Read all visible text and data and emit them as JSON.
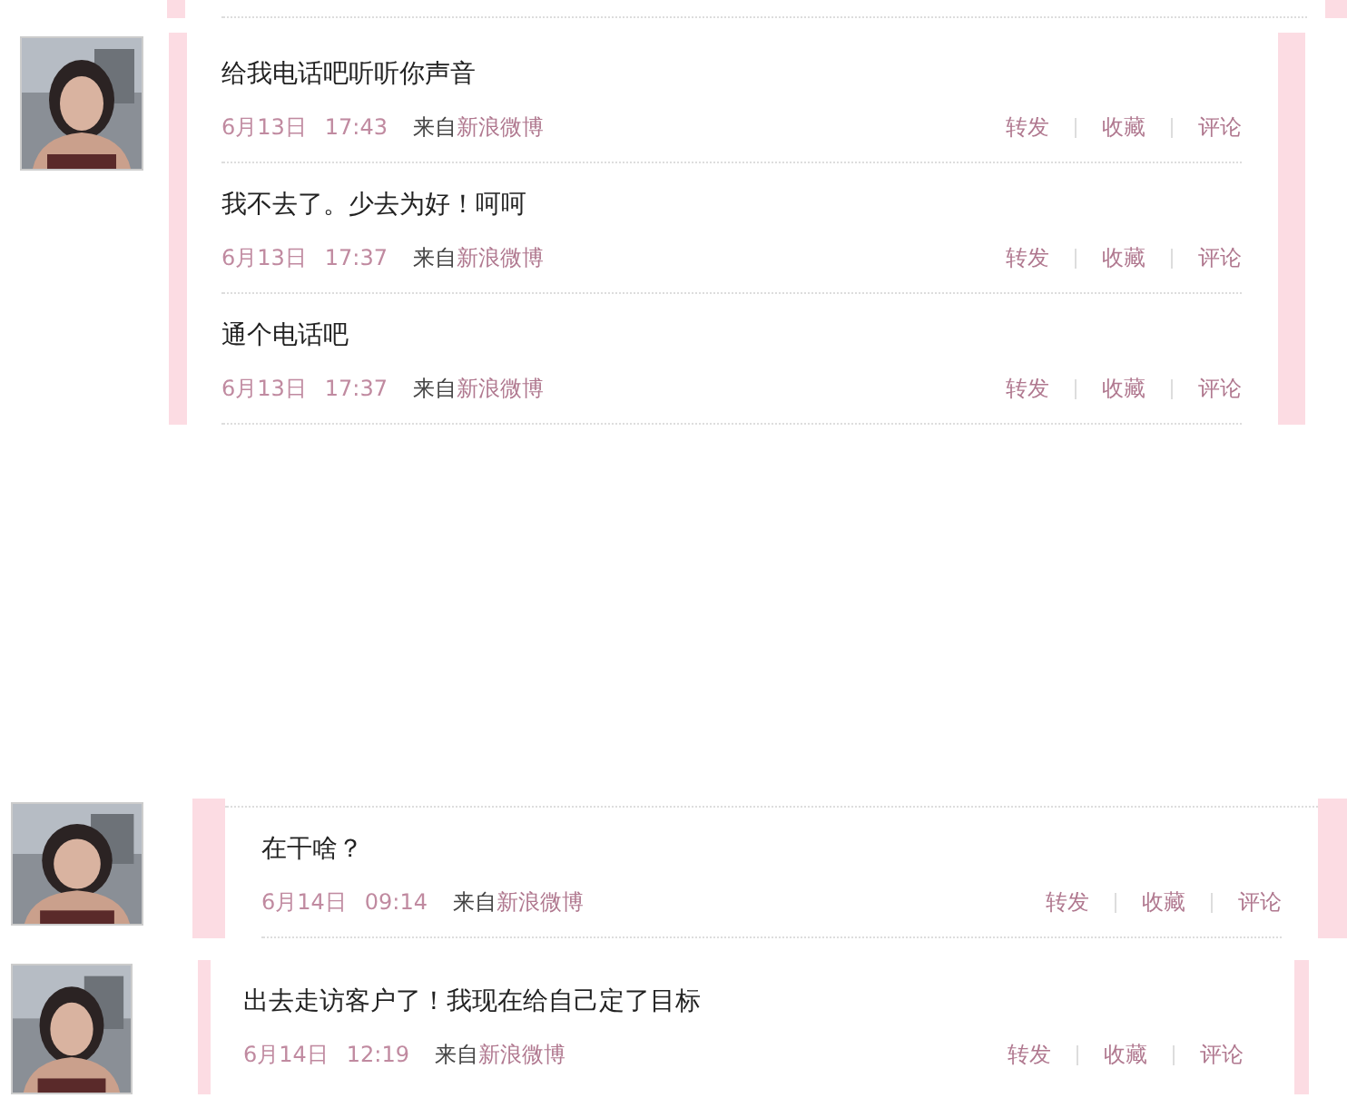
{
  "threads": [
    {
      "posts": [
        {
          "text": "给我电话吧听听你声音",
          "date": "6月13日",
          "time": "17:43",
          "source_prefix": "来自",
          "source": "新浪微博",
          "actions": [
            "转发",
            "收藏",
            "评论"
          ]
        },
        {
          "text": "我不去了。少去为好！呵呵",
          "date": "6月13日",
          "time": "17:37",
          "source_prefix": "来自",
          "source": "新浪微博",
          "actions": [
            "转发",
            "收藏",
            "评论"
          ]
        },
        {
          "text": "通个电话吧",
          "date": "6月13日",
          "time": "17:37",
          "source_prefix": "来自",
          "source": "新浪微博",
          "actions": [
            "转发",
            "收藏",
            "评论"
          ]
        }
      ]
    },
    {
      "posts": [
        {
          "text": "在干啥？",
          "date": "6月14日",
          "time": "09:14",
          "source_prefix": "来自",
          "source": "新浪微博",
          "actions": [
            "转发",
            "收藏",
            "评论"
          ]
        }
      ]
    },
    {
      "posts": [
        {
          "text": "出去走访客户了！我现在给自己定了目标",
          "date": "6月14日",
          "time": "12:19",
          "source_prefix": "来自",
          "source": "新浪微博",
          "actions": [
            "转发",
            "收藏",
            "评论"
          ]
        }
      ]
    }
  ]
}
